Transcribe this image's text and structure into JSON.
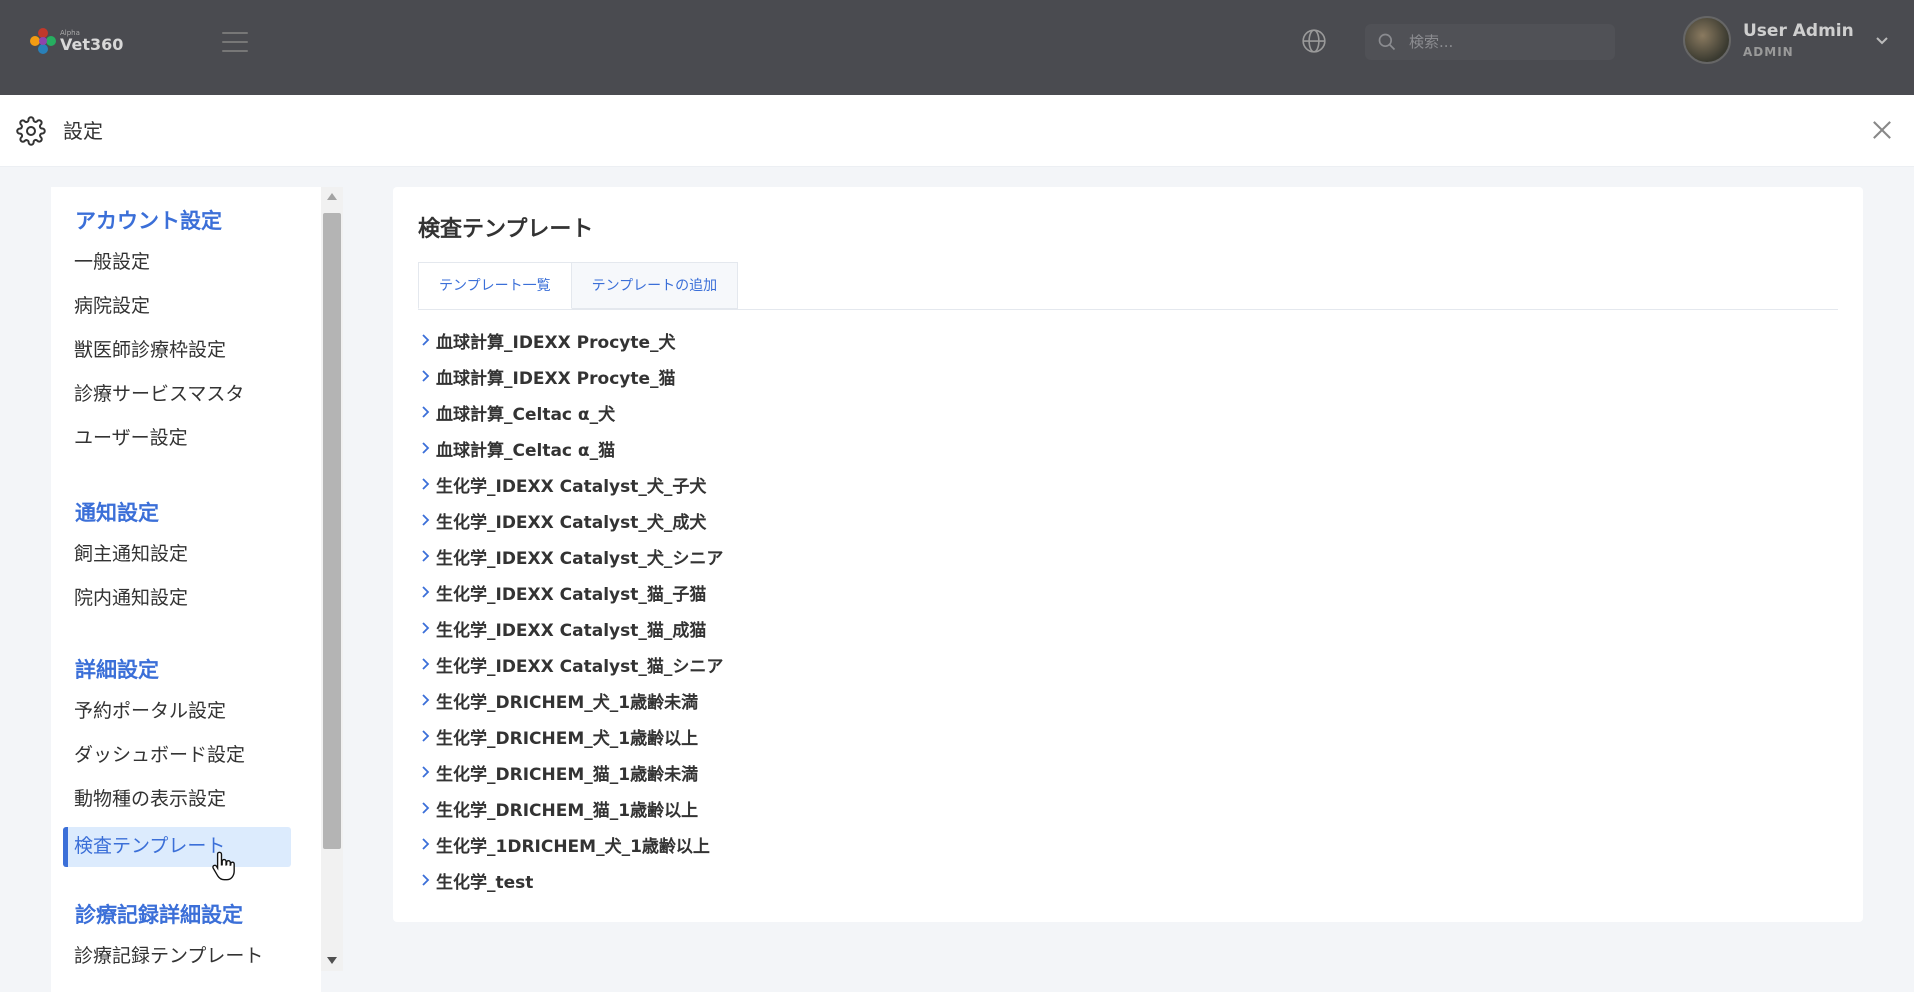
{
  "app": {
    "logo_small": "Alpha",
    "logo_text": "Vet360"
  },
  "header": {
    "search_placeholder": "検索...",
    "user_name": "User Admin",
    "user_role": "ADMIN"
  },
  "modal": {
    "title": "設定"
  },
  "sidebar": {
    "sections": [
      {
        "title": "アカウント設定",
        "items": [
          "一般設定",
          "病院設定",
          "獣医師診療枠設定",
          "診療サービスマスタ",
          "ユーザー設定"
        ]
      },
      {
        "title": "通知設定",
        "items": [
          "飼主通知設定",
          "院内通知設定"
        ]
      },
      {
        "title": "詳細設定",
        "items": [
          "予約ポータル設定",
          "ダッシュボード設定",
          "動物種の表示設定",
          "検査テンプレート"
        ]
      },
      {
        "title": "診療記録詳細設定",
        "items": [
          "診療記録テンプレート"
        ]
      }
    ],
    "active_item": "検査テンプレート"
  },
  "main": {
    "title": "検査テンプレート",
    "tabs": [
      {
        "label": "テンプレート一覧",
        "active": true
      },
      {
        "label": "テンプレートの追加",
        "active": false
      }
    ],
    "templates": [
      "血球計算_IDEXX Procyte_犬",
      "血球計算_IDEXX Procyte_猫",
      "血球計算_Celtac α_犬",
      "血球計算_Celtac α_猫",
      "生化学_IDEXX Catalyst_犬_子犬",
      "生化学_IDEXX Catalyst_犬_成犬",
      "生化学_IDEXX Catalyst_犬_シニア",
      "生化学_IDEXX Catalyst_猫_子猫",
      "生化学_IDEXX Catalyst_猫_成猫",
      "生化学_IDEXX Catalyst_猫_シニア",
      "生化学_DRICHEM_犬_1歳齢未満",
      "生化学_DRICHEM_犬_1歳齢以上",
      "生化学_DRICHEM_猫_1歳齢未満",
      "生化学_DRICHEM_猫_1歳齢以上",
      "生化学_1DRICHEM_犬_1歳齢以上",
      "生化学_test"
    ]
  },
  "colors": {
    "accent": "#3b6fd8",
    "topbar": "#4a4b50",
    "active_bg": "#dcebfd"
  }
}
